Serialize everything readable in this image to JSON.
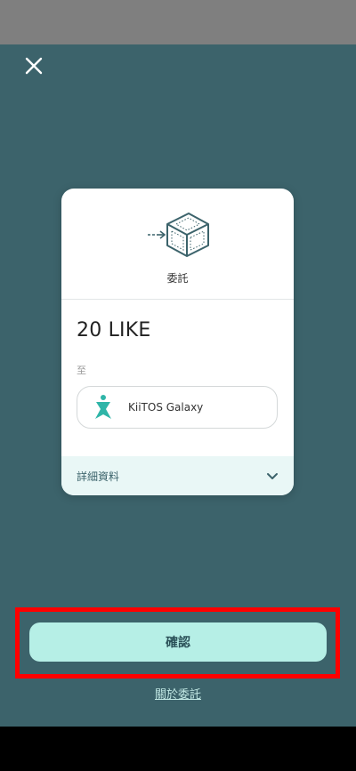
{
  "header": {
    "close_icon": "close-icon"
  },
  "card": {
    "action_icon": "delegate-box-icon",
    "action_title": "委託",
    "amount": "20 LIKE",
    "to_label": "至",
    "validator": {
      "name": "KiiTOS Galaxy",
      "avatar_icon": "kiitos-logo-icon"
    },
    "details_label": "詳細資料",
    "details_icon": "chevron-down-icon"
  },
  "footer": {
    "confirm_label": "確認",
    "about_link": "關於委託"
  },
  "colors": {
    "background": "#3c636b",
    "accent": "#b6efe6",
    "highlight_frame": "#ff0000"
  }
}
